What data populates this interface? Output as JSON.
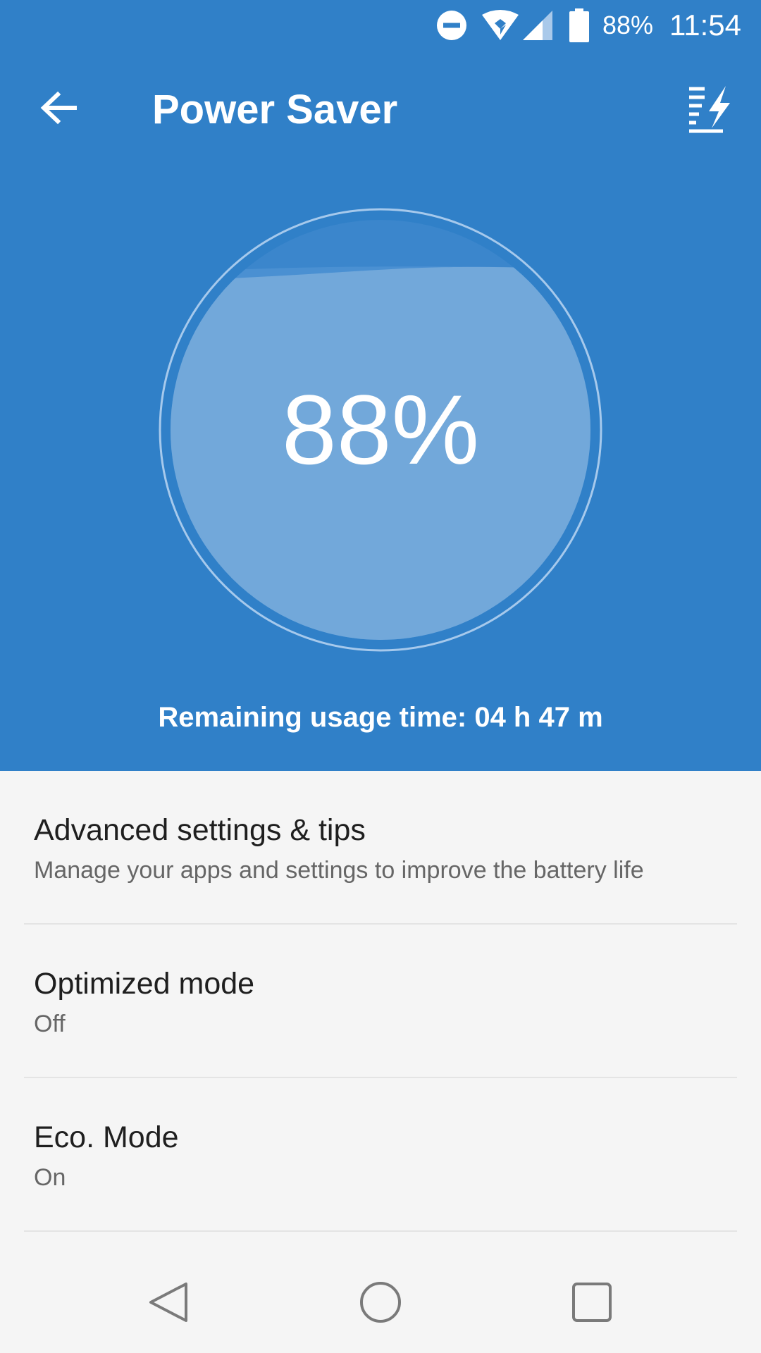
{
  "status_bar": {
    "battery_percent": "88%",
    "time": "11:54",
    "icons": [
      "do-not-disturb-icon",
      "wifi-icon",
      "cell-signal-icon",
      "battery-icon"
    ]
  },
  "toolbar": {
    "title": "Power Saver",
    "back_icon": "arrow-left-icon",
    "action_icon": "power-saver-settings-icon"
  },
  "battery": {
    "level_display": "88%",
    "level_fraction": 0.88,
    "remaining_text": "Remaining usage time: 04 h 47 m"
  },
  "settings": [
    {
      "title": "Advanced settings & tips",
      "subtitle": "Manage your apps and settings to improve the battery life"
    },
    {
      "title": "Optimized mode",
      "subtitle": "Off"
    },
    {
      "title": "Eco. Mode",
      "subtitle": "On"
    }
  ],
  "nav_bar": {
    "icons": [
      "back-triangle-icon",
      "home-circle-icon",
      "recents-square-icon"
    ]
  },
  "colors": {
    "header_bg": "#3080c8",
    "list_bg": "#f5f5f5",
    "water_fill": "#72a8da"
  }
}
